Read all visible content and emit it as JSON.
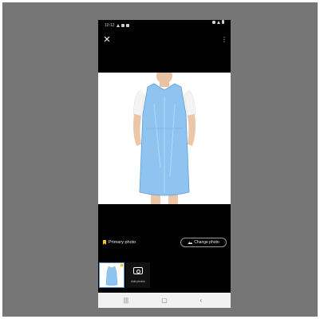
{
  "status_bar": {
    "time": "10:12",
    "left_icons": [
      "notification-icon",
      "cloud-icon",
      "battery-saver-icon"
    ],
    "right_icons": [
      "wifi-icon",
      "signal-icon",
      "battery-icon"
    ]
  },
  "toolbar": {
    "close_glyph": "✕",
    "more_glyph": "⋮"
  },
  "photo": {
    "subject": "blue disposable apron on model",
    "apron_color": "#8ec4ef",
    "shirt_color": "#f4f4f4",
    "background": "#ffffff"
  },
  "actions": {
    "primary_label": "Primary photo",
    "change_label": "Change photo"
  },
  "thumbnails": {
    "add_label": "Add photos"
  },
  "nav": {
    "recents_glyph": "|||",
    "home_glyph": "▢",
    "back_glyph": "‹"
  },
  "colors": {
    "screen_bg": "#000000",
    "outer_bg": "#767676",
    "accent_yellow": "#f5c518",
    "nav_bg": "#f1f1f1"
  }
}
